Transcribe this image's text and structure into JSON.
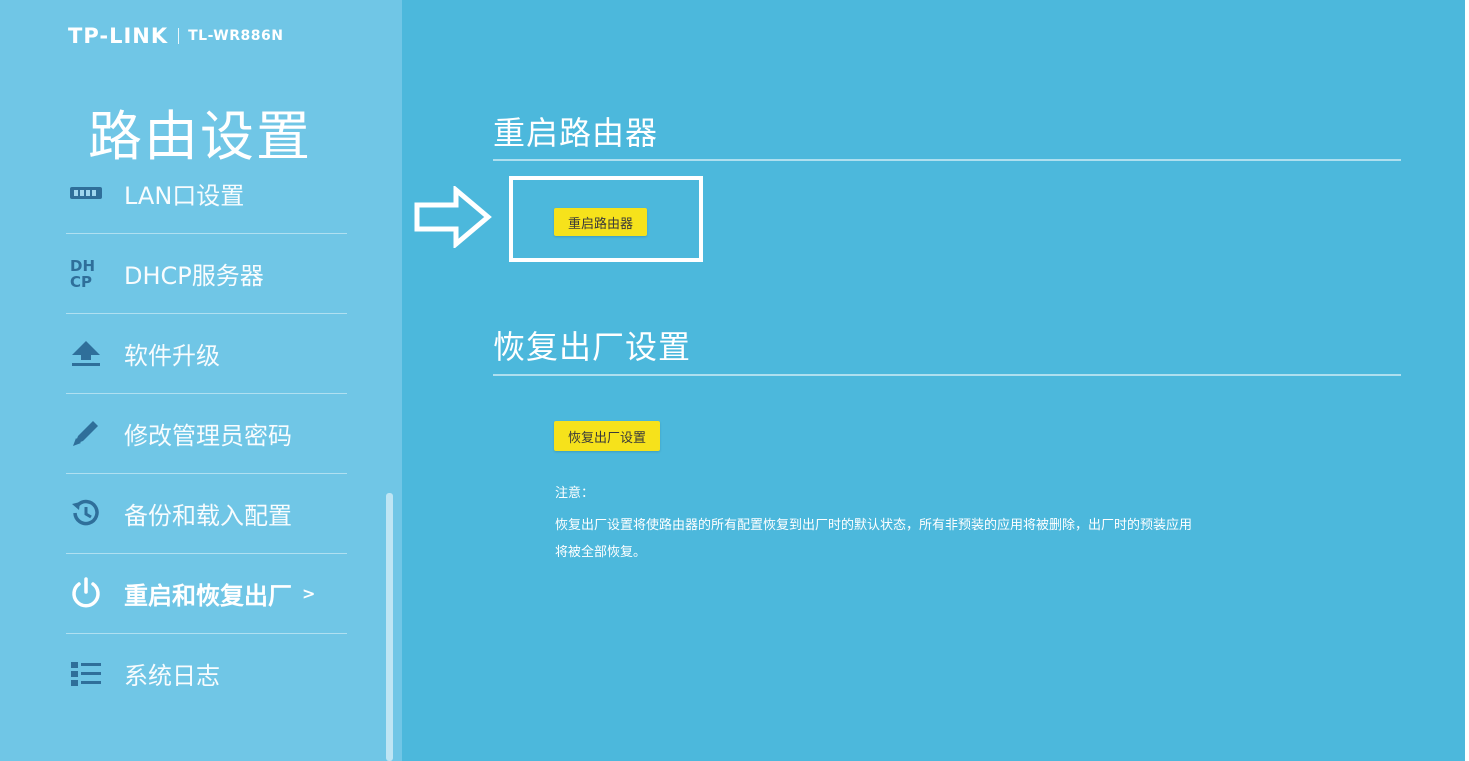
{
  "brand": {
    "logo": "TP-LINK",
    "model": "TL-WR886N"
  },
  "sidebar": {
    "title": "路由设置",
    "items": [
      {
        "label": "LAN口设置",
        "icon": "lan-port-icon"
      },
      {
        "label": "DHCP服务器",
        "icon": "dhcp-icon"
      },
      {
        "label": "软件升级",
        "icon": "upload-icon"
      },
      {
        "label": "修改管理员密码",
        "icon": "pencil-icon"
      },
      {
        "label": "备份和载入配置",
        "icon": "backup-restore-icon"
      },
      {
        "label": "重启和恢复出厂",
        "icon": "power-icon",
        "active": true,
        "chevron": ">"
      },
      {
        "label": "系统日志",
        "icon": "list-icon"
      }
    ]
  },
  "main": {
    "reboot": {
      "title": "重启路由器",
      "button": "重启路由器"
    },
    "factory": {
      "title": "恢复出厂设置",
      "button": "恢复出厂设置",
      "note_label": "注意：",
      "note_line1": "恢复出厂设置将使路由器的所有配置恢复到出厂时的默认状态，所有非预装的应用将被删除，出厂时的预装应用",
      "note_line2": "将被全部恢复。"
    }
  },
  "colors": {
    "background": "#4cb8dc",
    "sidebar": "#70c6e6",
    "button": "#f6e21b",
    "text": "#ffffff"
  }
}
